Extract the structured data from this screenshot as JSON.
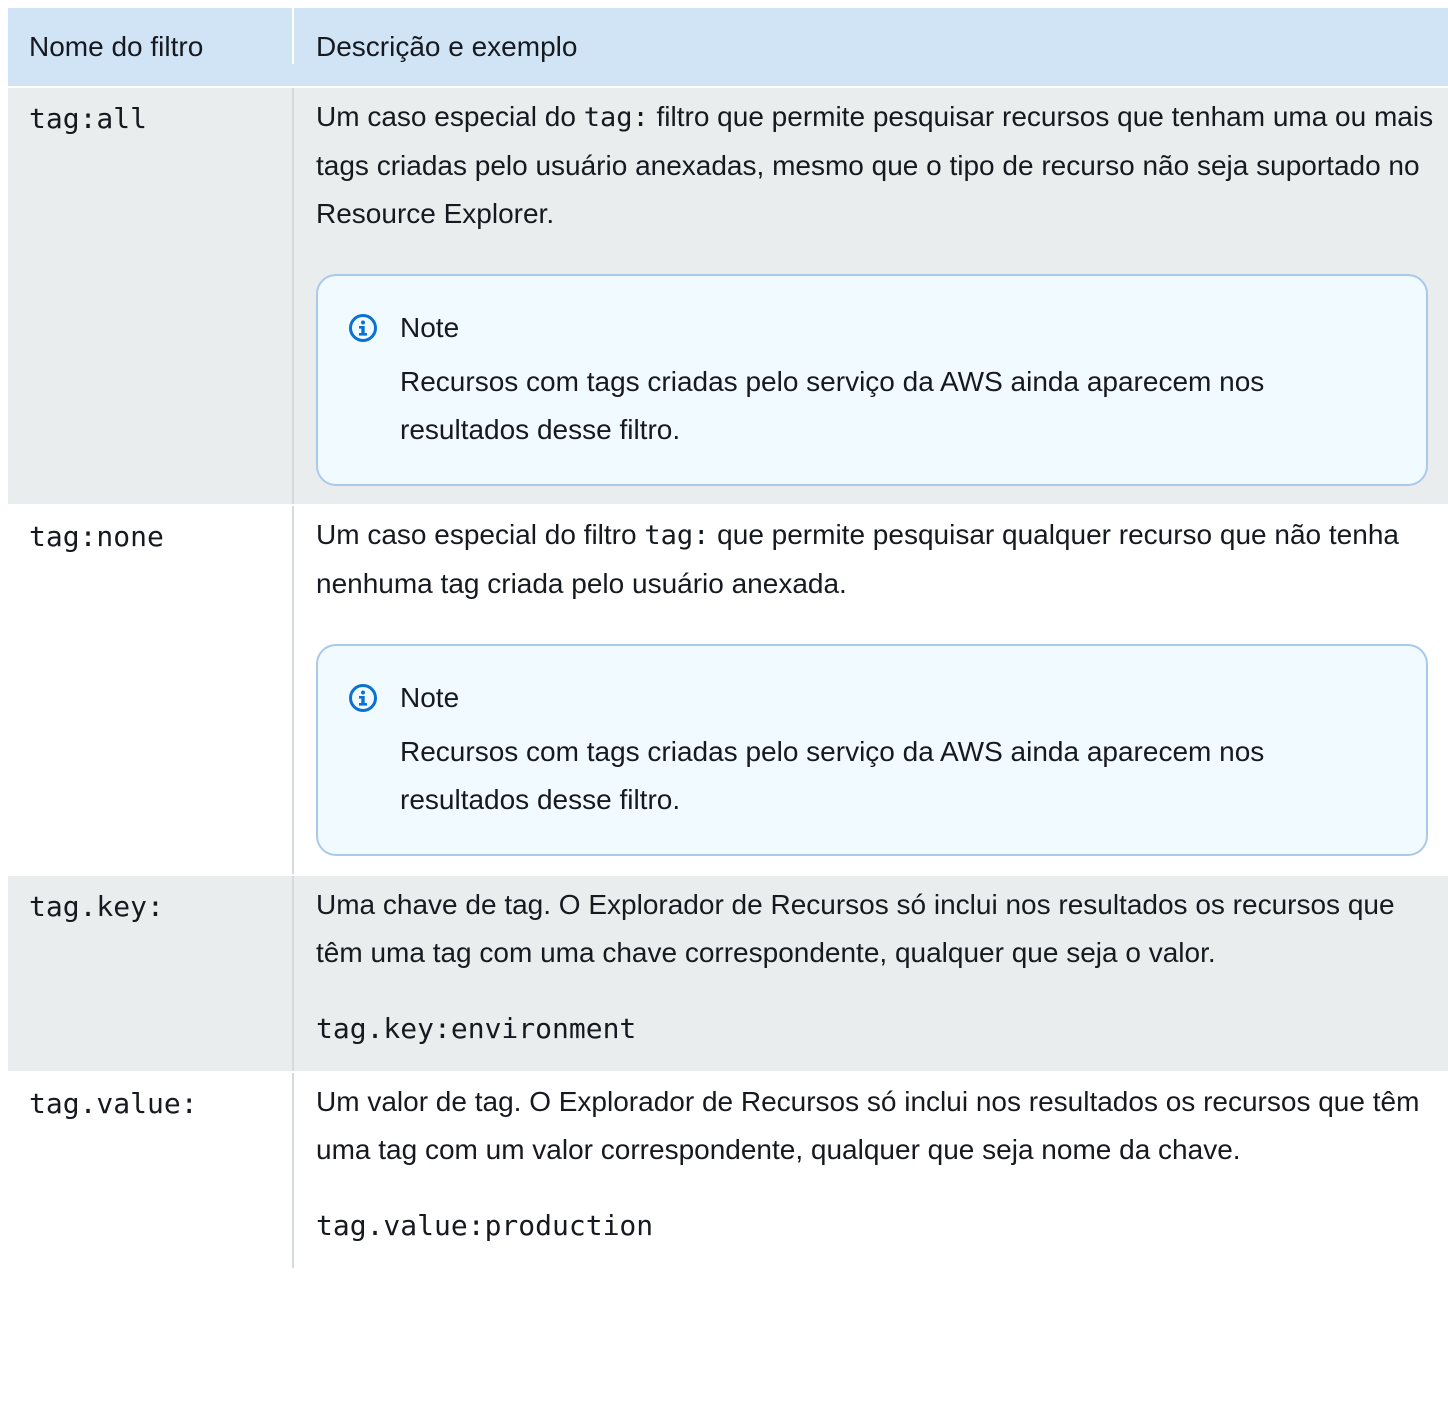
{
  "header": {
    "col1": "Nome do filtro",
    "col2": "Descrição e exemplo"
  },
  "rows": [
    {
      "name": "tag:all",
      "desc_before": "Um caso especial do ",
      "desc_code": "tag:",
      "desc_after": " filtro que permite pesquisar recursos que tenham uma ou mais tags criadas pelo usuário anexadas, mesmo que o tipo de recurso não seja suportado no Resource Explorer.",
      "note_title": "Note",
      "note_body": "Recursos com tags criadas pelo serviço da AWS  ainda aparecem nos resultados desse filtro."
    },
    {
      "name": "tag:none",
      "desc_before": "Um caso especial do filtro ",
      "desc_code": "tag:",
      "desc_after": " que permite pesquisar qualquer recurso que não tenha nenhuma tag criada pelo usuário anexada.",
      "note_title": "Note",
      "note_body": "Recursos com tags criadas pelo serviço da AWS  ainda aparecem nos resultados desse filtro."
    },
    {
      "name": "tag.key:",
      "desc": "Uma chave de tag. O Explorador de Recursos só inclui nos resultados os recursos que têm uma tag com uma chave correspondente, qualquer que seja o valor.",
      "example": "tag.key:environment"
    },
    {
      "name": "tag.value:",
      "desc": "Um valor de tag. O Explorador de Recursos só inclui nos resultados os recursos que têm uma tag com um valor correspondente, qualquer que seja nome da chave.",
      "example": "tag.value:production"
    }
  ],
  "icons": {
    "note": "info-icon",
    "note_color": "#0972d3"
  }
}
